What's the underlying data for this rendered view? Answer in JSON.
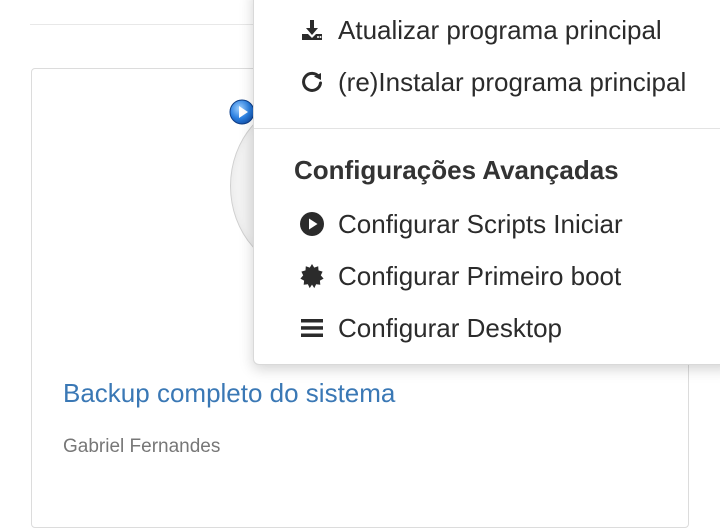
{
  "card": {
    "title": "Backup completo do sistema",
    "author": "Gabriel Fernandes"
  },
  "menu": {
    "items_top": [
      {
        "label": "Atualizar programa principal",
        "icon": "download-icon"
      },
      {
        "label": "(re)Instalar programa principal",
        "icon": "refresh-icon"
      }
    ],
    "advanced_header": "Configurações Avançadas",
    "items_advanced": [
      {
        "label": "Configurar Scripts Iniciar",
        "icon": "play-circle-icon"
      },
      {
        "label": "Configurar Primeiro boot",
        "icon": "certificate-icon"
      },
      {
        "label": "Configurar Desktop",
        "icon": "bars-icon"
      }
    ]
  },
  "colors": {
    "link": "#3a78b5",
    "muted_text": "#777777",
    "menu_text": "#2b2b2b"
  }
}
